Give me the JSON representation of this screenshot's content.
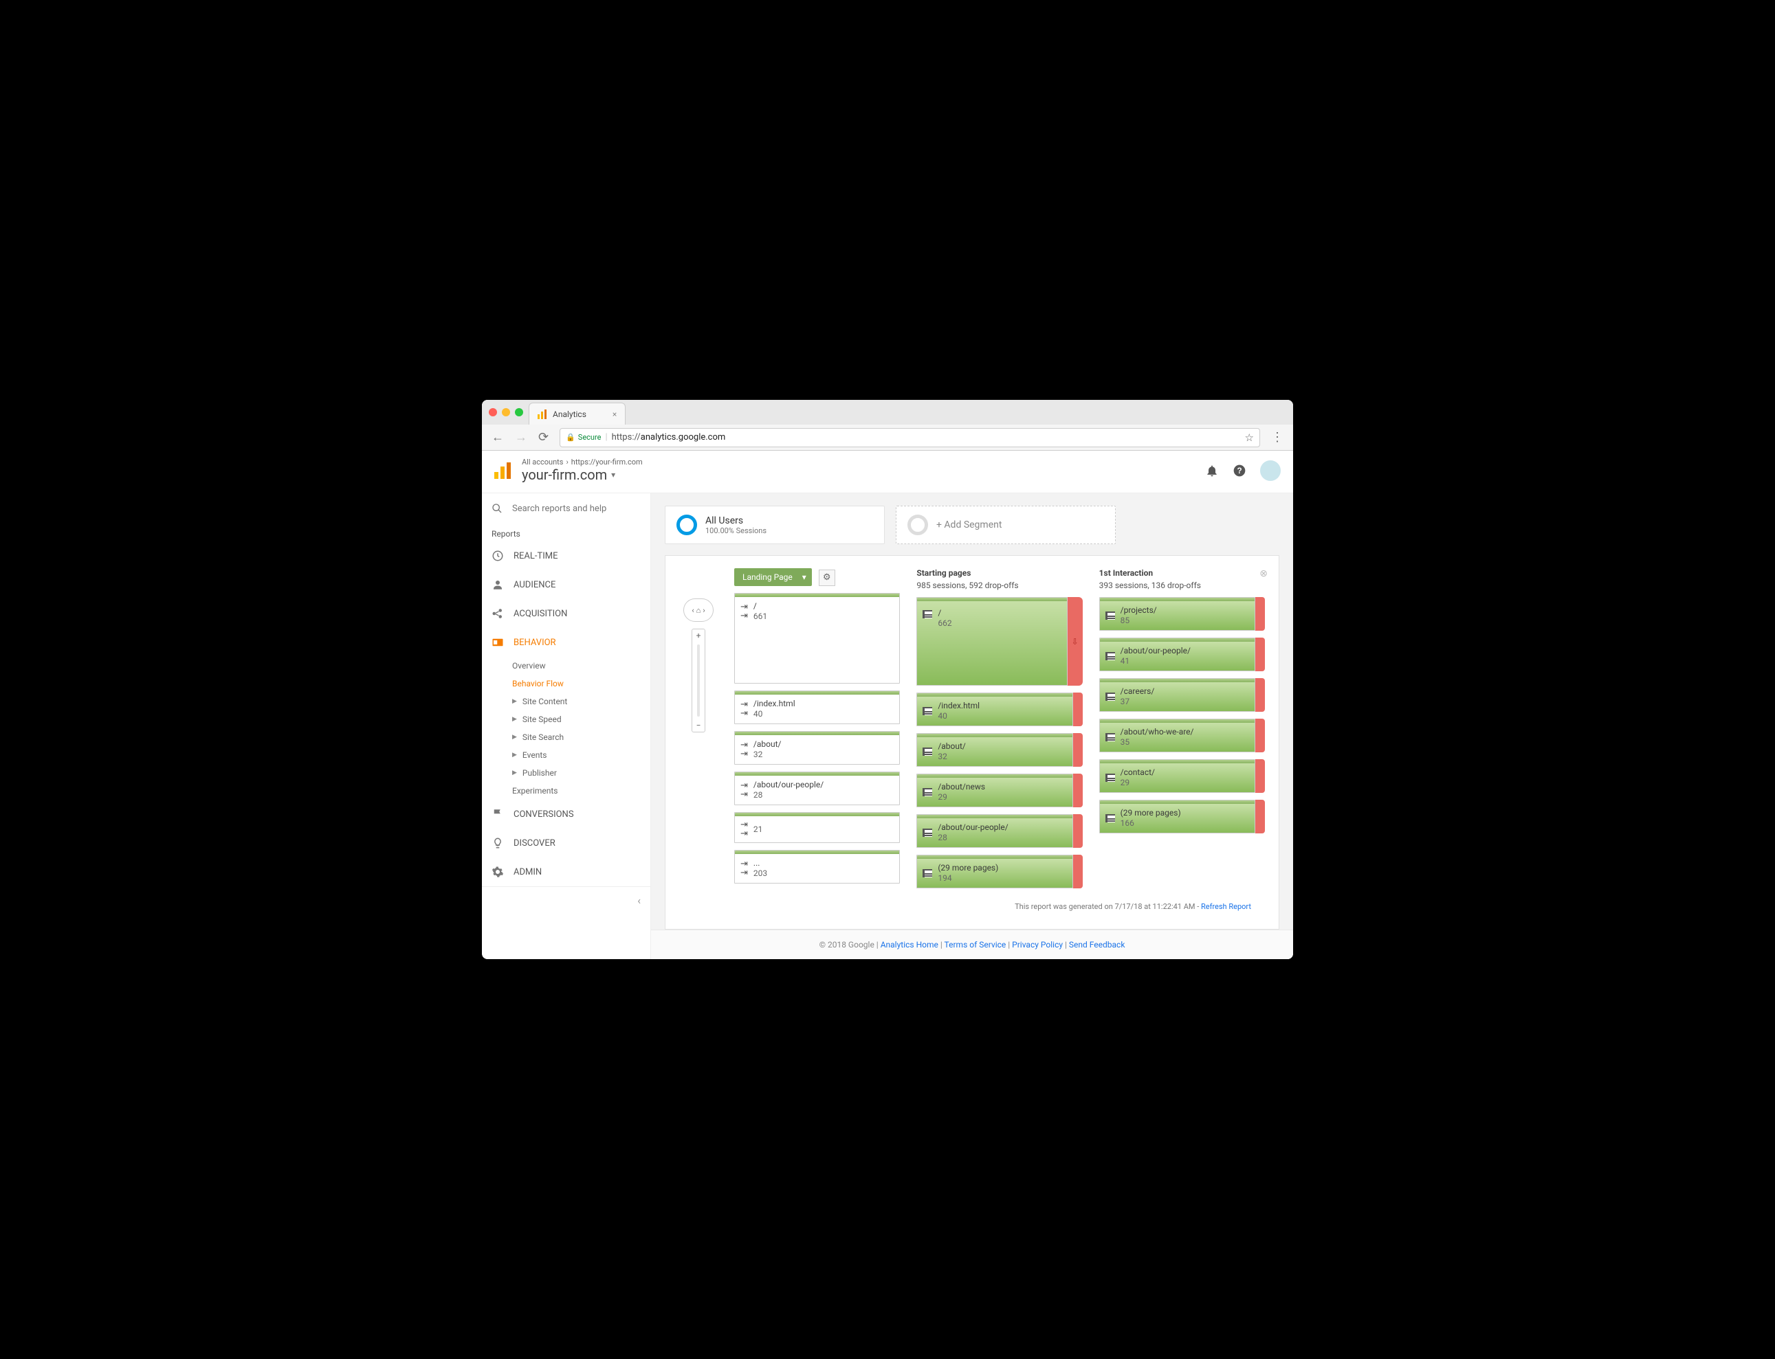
{
  "browser": {
    "tab_title": "Analytics",
    "secure_label": "Secure",
    "url_prefix": "https://",
    "url_host": "analytics.google.com"
  },
  "header": {
    "breadcrumb_all": "All accounts",
    "breadcrumb_prop": "https://your-firm.com",
    "title": "your-firm.com"
  },
  "sidebar": {
    "search_placeholder": "Search reports and help",
    "reports_label": "Reports",
    "items": {
      "realtime": "REAL-TIME",
      "audience": "AUDIENCE",
      "acquisition": "ACQUISITION",
      "behavior": "BEHAVIOR",
      "conversions": "CONVERSIONS",
      "discover": "DISCOVER",
      "admin": "ADMIN"
    },
    "behavior_sub": {
      "overview": "Overview",
      "flow": "Behavior Flow",
      "site_content": "Site Content",
      "site_speed": "Site Speed",
      "site_search": "Site Search",
      "events": "Events",
      "publisher": "Publisher",
      "experiments": "Experiments"
    }
  },
  "segments": {
    "all_users": "All Users",
    "all_users_sub": "100.00% Sessions",
    "add": "+ Add Segment"
  },
  "flow": {
    "landing_label": "Landing Page",
    "col_start": {
      "title": "Starting pages",
      "sub": "985 sessions, 592 drop-offs"
    },
    "col_first": {
      "title": "1st Interaction",
      "sub": "393 sessions, 136 drop-offs"
    },
    "landing_nodes": [
      {
        "path": "/",
        "count": "661"
      },
      {
        "path": "/index.html",
        "count": "40"
      },
      {
        "path": "/about/",
        "count": "32"
      },
      {
        "path": "/about/our-people/",
        "count": "28"
      },
      {
        "path": "",
        "count": "21"
      },
      {
        "path": "...",
        "count": "203"
      }
    ],
    "start_nodes": [
      {
        "path": "/",
        "count": "662"
      },
      {
        "path": "/index.html",
        "count": "40"
      },
      {
        "path": "/about/",
        "count": "32"
      },
      {
        "path": "/about/news",
        "count": "29"
      },
      {
        "path": "/about/our-people/",
        "count": "28"
      },
      {
        "path": "(29 more pages)",
        "count": "194"
      }
    ],
    "first_nodes": [
      {
        "path": "/projects/",
        "count": "85"
      },
      {
        "path": "/about/our-people/",
        "count": "41"
      },
      {
        "path": "/careers/",
        "count": "37"
      },
      {
        "path": "/about/who-we-are/",
        "count": "35"
      },
      {
        "path": "/contact/",
        "count": "29"
      },
      {
        "path": "(29 more pages)",
        "count": "166"
      }
    ]
  },
  "footer": {
    "report_gen": "This report was generated on 7/17/18 at 11:22:41 AM - ",
    "refresh": "Refresh Report",
    "copyright": "© 2018 Google | ",
    "links": {
      "home": "Analytics Home",
      "tos": "Terms of Service",
      "privacy": "Privacy Policy",
      "feedback": "Send Feedback"
    }
  }
}
